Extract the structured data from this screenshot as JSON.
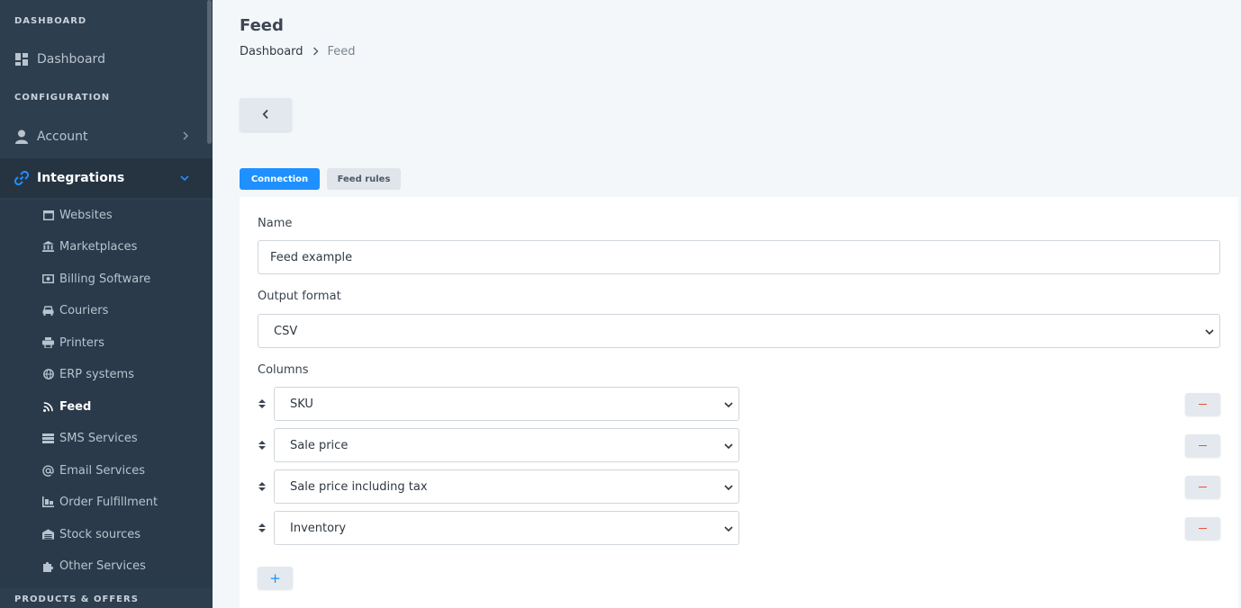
{
  "sidebar": {
    "sections": {
      "dashboard": "DASHBOARD",
      "configuration": "CONFIGURATION",
      "products": "PRODUCTS & OFFERS"
    },
    "dashboard_label": "Dashboard",
    "account_label": "Account",
    "integrations_label": "Integrations",
    "integrations_sub": [
      {
        "label": "Websites",
        "icon": "window-icon"
      },
      {
        "label": "Marketplaces",
        "icon": "bank-icon"
      },
      {
        "label": "Billing Software",
        "icon": "money-icon"
      },
      {
        "label": "Couriers",
        "icon": "car-icon"
      },
      {
        "label": "Printers",
        "icon": "printer-icon"
      },
      {
        "label": "ERP systems",
        "icon": "globe-icon"
      },
      {
        "label": "Feed",
        "icon": "rss-icon"
      },
      {
        "label": "SMS Services",
        "icon": "server-icon"
      },
      {
        "label": "Email Services",
        "icon": "at-icon"
      },
      {
        "label": "Order Fulfillment",
        "icon": "pallet-icon"
      },
      {
        "label": "Stock sources",
        "icon": "warehouse-icon"
      },
      {
        "label": "Other Services",
        "icon": "puzzle-icon"
      }
    ],
    "active_sub": "Feed"
  },
  "header": {
    "title": "Feed",
    "breadcrumb": {
      "home": "Dashboard",
      "current": "Feed"
    }
  },
  "tabs": {
    "connection": "Connection",
    "feed_rules": "Feed rules",
    "active": "Connection"
  },
  "form": {
    "name_label": "Name",
    "name_value": "Feed example",
    "output_label": "Output format",
    "output_value": "CSV",
    "columns_label": "Columns",
    "columns": [
      "SKU",
      "Sale price",
      "Sale price including tax",
      "Inventory"
    ],
    "add_symbol": "+"
  },
  "colors": {
    "sidebar_bg": "#2d3e4f",
    "accent": "#1e90ff",
    "remove": "#e6533c"
  }
}
